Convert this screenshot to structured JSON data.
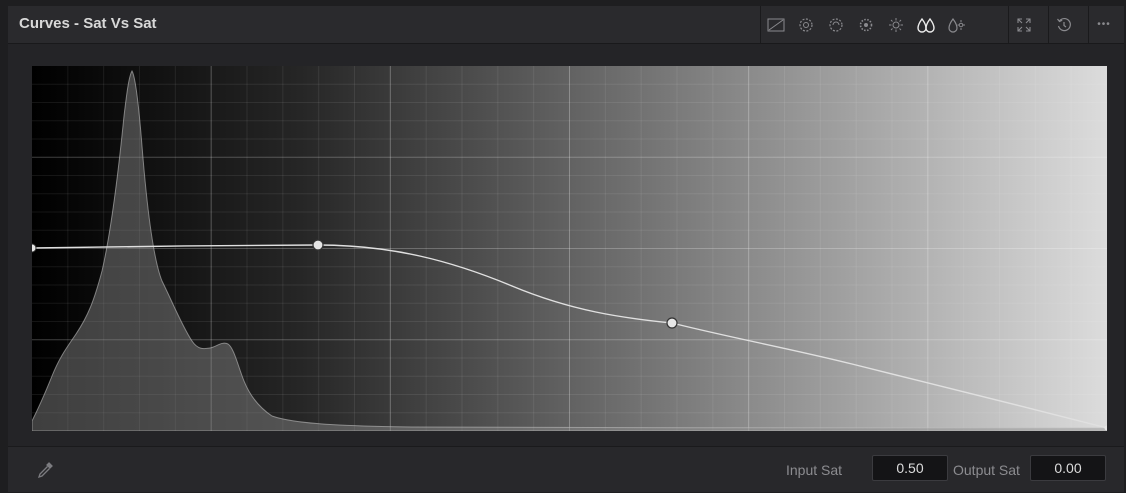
{
  "header": {
    "title": "Curves - Sat Vs Sat",
    "modes": [
      {
        "icon": "custom-curve-icon",
        "glyph": "◿"
      },
      {
        "icon": "hue-vs-hue-icon",
        "glyph": "❂"
      },
      {
        "icon": "hue-vs-sat-icon",
        "glyph": "❂"
      },
      {
        "icon": "hue-vs-lum-icon",
        "glyph": "✺"
      },
      {
        "icon": "lum-vs-sat-icon",
        "glyph": "✹"
      },
      {
        "icon": "sat-vs-sat-icon",
        "glyph": "ⴰ"
      },
      {
        "icon": "sat-vs-lum-icon",
        "glyph": "✺"
      }
    ],
    "active_mode": 5,
    "expand_icon": "expand-icon",
    "reset_icon": "reset-icon",
    "more_glyph": "•••"
  },
  "footer": {
    "input_label": "Input Sat",
    "input_value": "0.50",
    "output_label": "Output Sat",
    "output_value": "0.00",
    "picker_icon": "eyedropper-icon"
  },
  "colors": {
    "panel_bg": "#252528",
    "curve": "#d9d9d9",
    "histogram_fill": "#6e6e6e",
    "gradient_start": "#000000",
    "gradient_end": "#dcdcdc"
  }
}
